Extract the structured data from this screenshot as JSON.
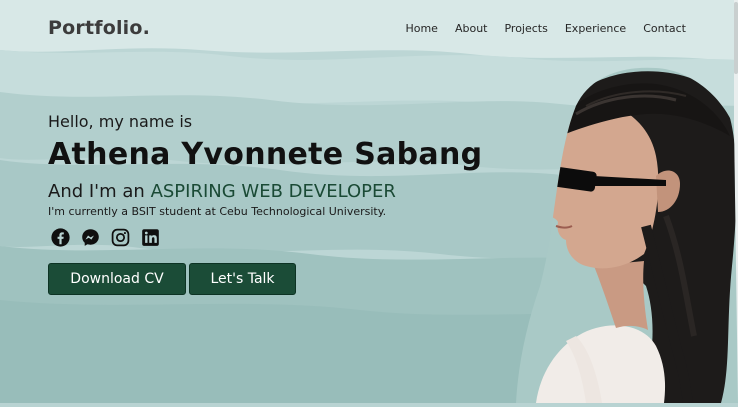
{
  "header": {
    "logo": "Portfolio.",
    "nav": [
      "Home",
      "About",
      "Projects",
      "Experience",
      "Contact"
    ]
  },
  "hero": {
    "greeting": "Hello, my name is",
    "name": "Athena Yvonnete Sabang",
    "role_prefix": "And I'm an",
    "role_highlight": "ASPIRING WEB DEVELOPER",
    "description": "I'm currently a BSIT student at Cebu Technological University.",
    "socials": [
      "facebook-icon",
      "messenger-icon",
      "instagram-icon",
      "linkedin-icon"
    ],
    "buttons": {
      "download": "Download CV",
      "talk": "Let's Talk"
    }
  },
  "colors": {
    "accent": "#1b4c37",
    "background": "#b8d3d2"
  }
}
